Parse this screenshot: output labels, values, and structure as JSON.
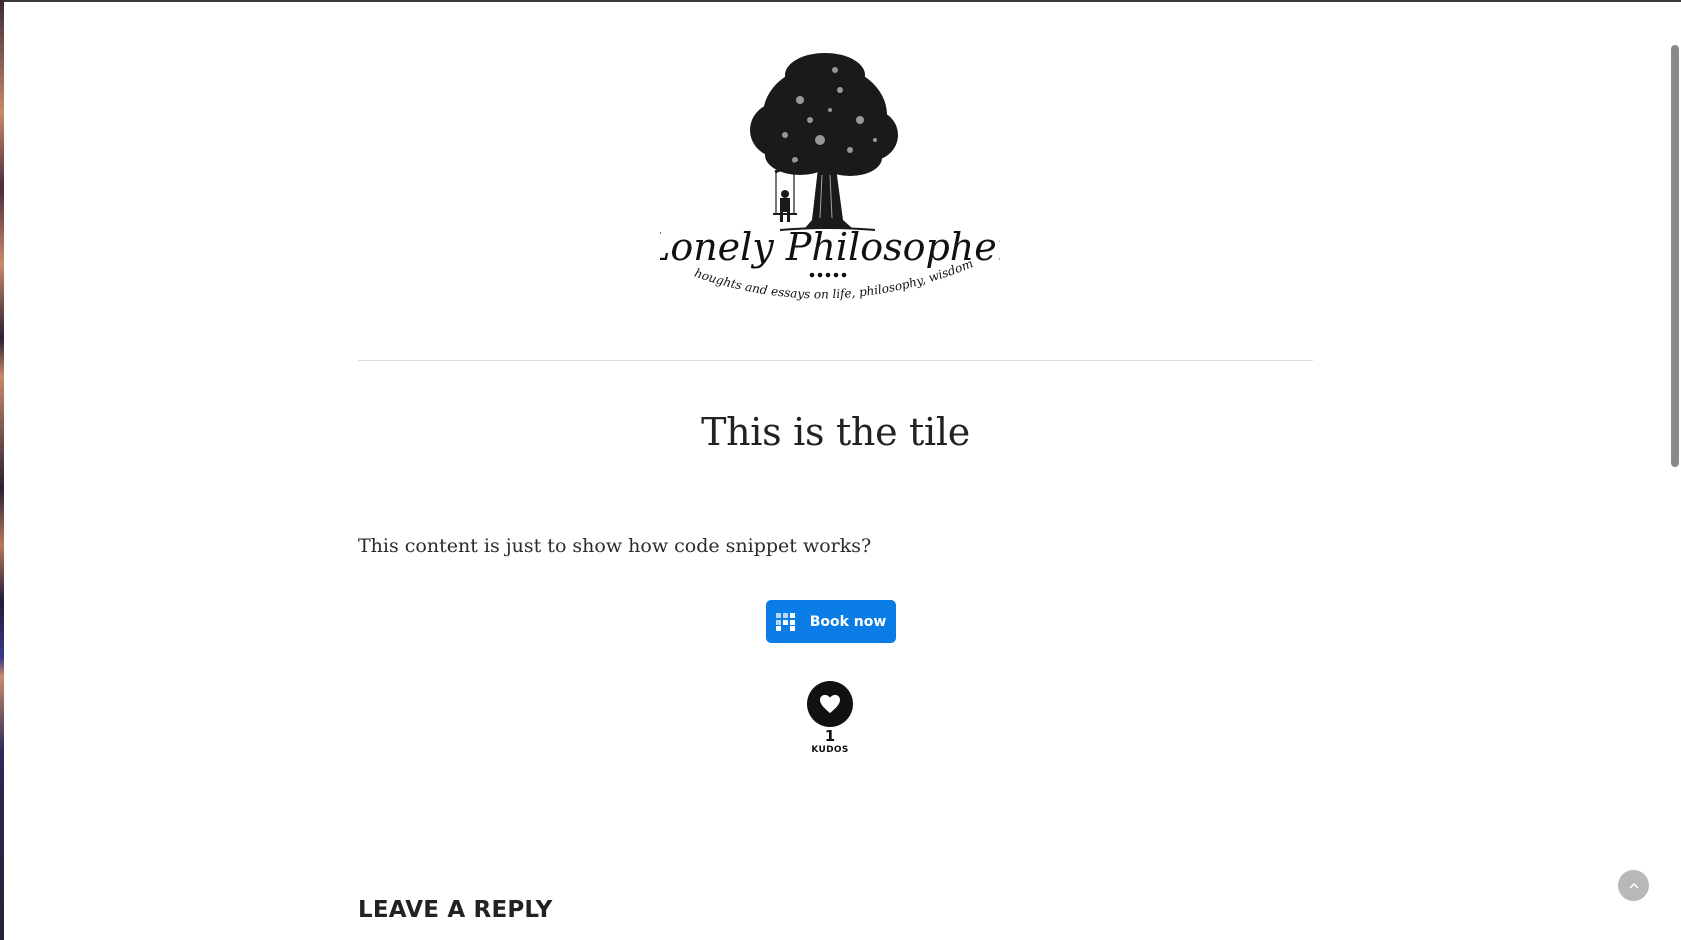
{
  "logo": {
    "title": "Lonely Philosopher",
    "tagline": "Thoughts and essays on life, philosophy, wisdom",
    "icon": "tree-swing-logo"
  },
  "post": {
    "title": "This is the tile",
    "content": "This content is just to show how code snippet works?"
  },
  "booking": {
    "label": "Book now",
    "icon": "booking-grid-icon",
    "color": "#0a7ce6"
  },
  "kudos": {
    "count": "1",
    "label": "KUDOS",
    "icon": "heart-icon"
  },
  "comments": {
    "heading": "LEAVE A REPLY"
  },
  "back_to_top": {
    "icon": "chevron-up-icon"
  }
}
